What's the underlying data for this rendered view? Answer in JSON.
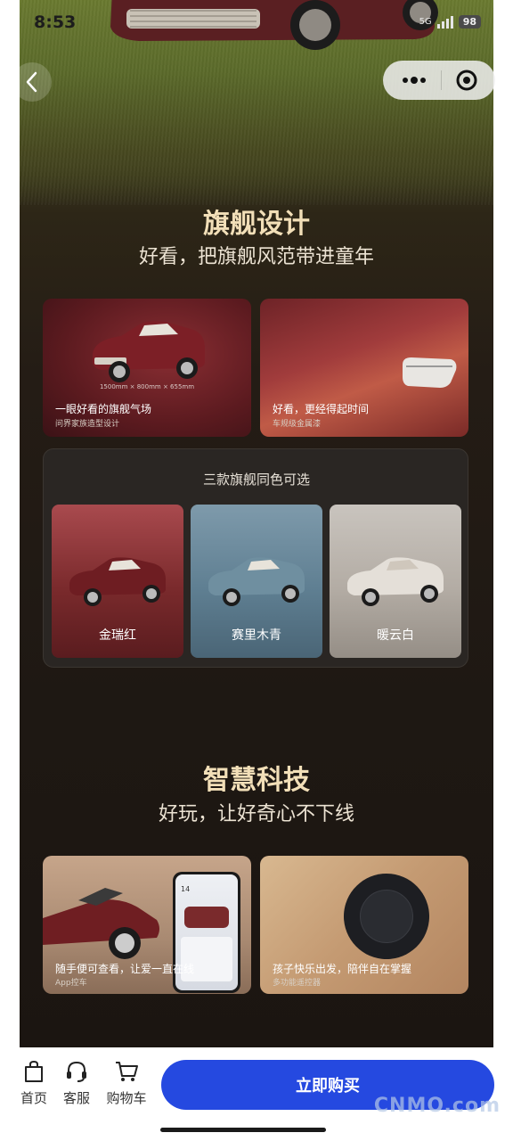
{
  "status_bar": {
    "time": "8:53",
    "network": "5G",
    "battery": "98"
  },
  "sections": {
    "design": {
      "title": "旗舰设计",
      "subtitle": "好看，把旗舰风范带进童年",
      "cards": [
        {
          "dimensions": "1500mm × 800mm × 655mm",
          "caption": "一眼好看的旗舰气场",
          "sub": "问界家族造型设计"
        },
        {
          "caption": "好看，更经得起时间",
          "sub": "车规级金属漆"
        }
      ]
    },
    "colors": {
      "title": "三款旗舰同色可选",
      "options": [
        {
          "label": "金瑞红",
          "color": "#7a2a2c"
        },
        {
          "label": "赛里木青",
          "color": "#5f7f92"
        },
        {
          "label": "暖云白",
          "color": "#d8d3cc"
        }
      ]
    },
    "tech": {
      "title": "智慧科技",
      "subtitle": "好玩，让好奇心不下线",
      "cards": [
        {
          "caption": "随手便可查看，让爱一直在线",
          "sub": "App控车",
          "phone_time": "14"
        },
        {
          "caption": "孩子快乐出发，陪伴自在掌握",
          "sub": "多功能遥控器"
        }
      ]
    }
  },
  "bottom_bar": {
    "tabs": [
      {
        "label": "首页",
        "icon": "shopping-bag-icon"
      },
      {
        "label": "客服",
        "icon": "headset-icon"
      },
      {
        "label": "购物车",
        "icon": "cart-icon"
      }
    ],
    "buy_button": "立即购买"
  },
  "watermark": "CNMO.com"
}
